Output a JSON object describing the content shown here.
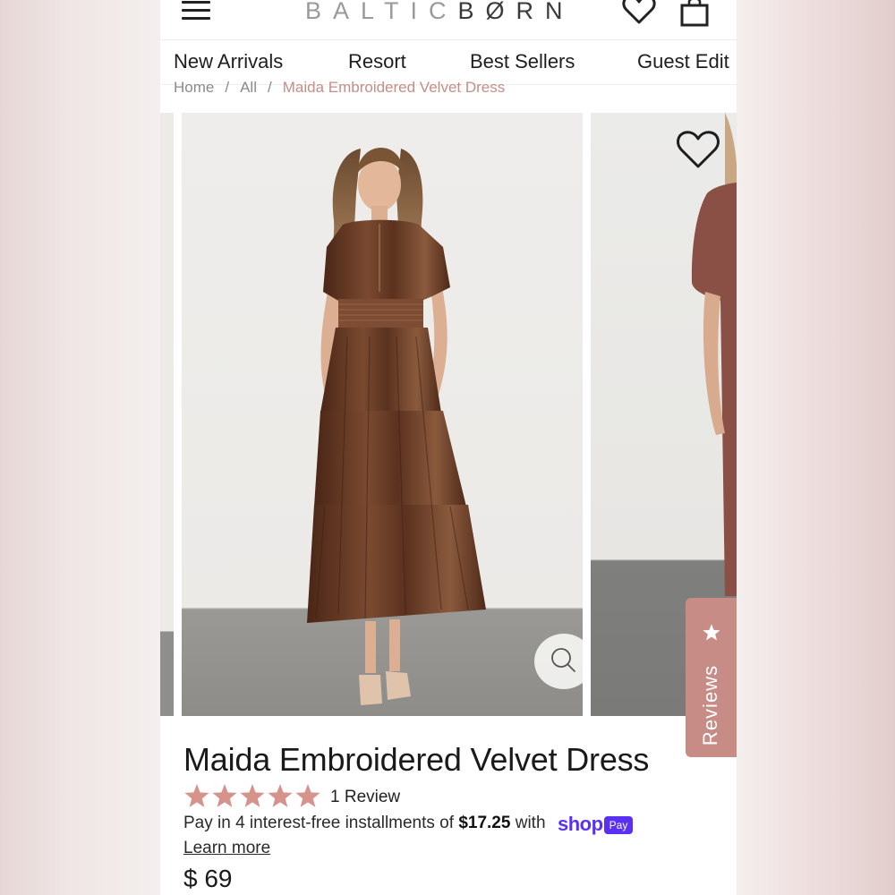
{
  "header": {
    "logo_part1": "BALTIC",
    "logo_part2": "BØRN",
    "icons": [
      "menu-icon",
      "heart-icon",
      "shopping-bag-icon"
    ]
  },
  "nav": {
    "items": [
      {
        "label": "New Arrivals"
      },
      {
        "label": "Resort"
      },
      {
        "label": "Best Sellers"
      },
      {
        "label": "Guest Edit"
      }
    ]
  },
  "breadcrumb": {
    "home": "Home",
    "sep1": "/",
    "all": "All",
    "sep2": "/",
    "current": "Maida Embroidered Velvet Dress"
  },
  "gallery": {
    "icons": [
      "zoom-icon",
      "heart-icon",
      "star-icon"
    ],
    "reviews_tab_label": "Reviews"
  },
  "product": {
    "title": "Maida Embroidered Velvet Dress",
    "rating_stars": 5,
    "review_count": "1 Review",
    "installments_prefix": "Pay in 4 interest-free installments of ",
    "installment_amount": "$17.25",
    "installments_suffix": " with",
    "shop_pay_logo": "shop",
    "shop_pay_badge": "Pay",
    "learn_more": "Learn more",
    "price": "$ 69"
  },
  "colors": {
    "accent_rose": "#c88c86",
    "breadcrumb_current": "#c48e88",
    "shop_pay_purple": "#5a31f4",
    "dress_brown": "#6b3b24"
  }
}
